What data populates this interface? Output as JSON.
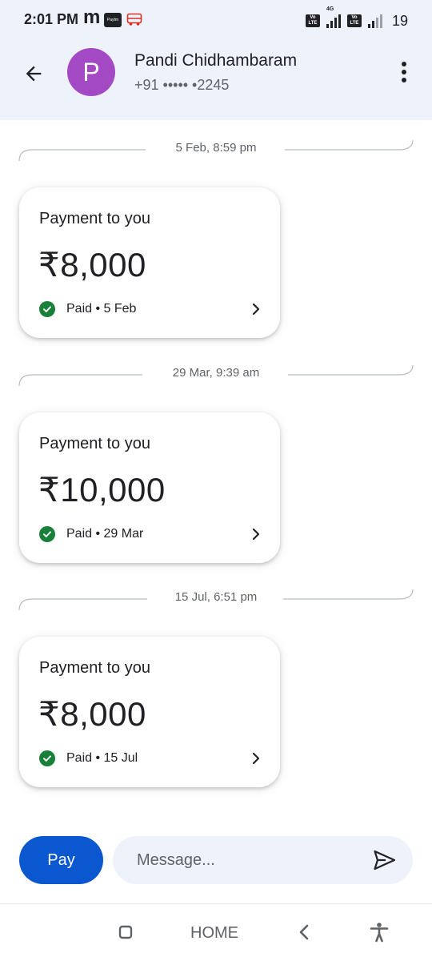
{
  "status_bar": {
    "time": "2:01 PM",
    "app_glyph": "m",
    "paytm_label": "Paytm",
    "network_type": "4G",
    "volte_label": "Vo LTE",
    "battery": "19"
  },
  "header": {
    "avatar_letter": "P",
    "avatar_color": "#a349c4",
    "contact_name": "Pandi Chidhambaram",
    "contact_phone": "+91 ••••• •2245"
  },
  "thread": {
    "entries": [
      {
        "timestamp": "5 Feb, 8:59 pm",
        "card_title": "Payment to you",
        "amount": "₹8,000",
        "status": "Paid • 5 Feb"
      },
      {
        "timestamp": "29 Mar, 9:39 am",
        "card_title": "Payment to you",
        "amount": "₹10,000",
        "status": "Paid • 29 Mar"
      },
      {
        "timestamp": "15 Jul, 6:51 pm",
        "card_title": "Payment to you",
        "amount": "₹8,000",
        "status": "Paid • 15 Jul"
      }
    ]
  },
  "composer": {
    "pay_label": "Pay",
    "message_placeholder": "Message..."
  },
  "nav_bar": {
    "home_label": "HOME"
  },
  "colors": {
    "header_bg": "#eef2fb",
    "accent": "#0b57d0",
    "paid_green": "#188038"
  },
  "icons": [
    "back-arrow-icon",
    "more-vert-icon",
    "check-circle-icon",
    "chevron-right-icon",
    "send-icon",
    "recents-square-icon",
    "nav-back-icon",
    "accessibility-icon"
  ]
}
